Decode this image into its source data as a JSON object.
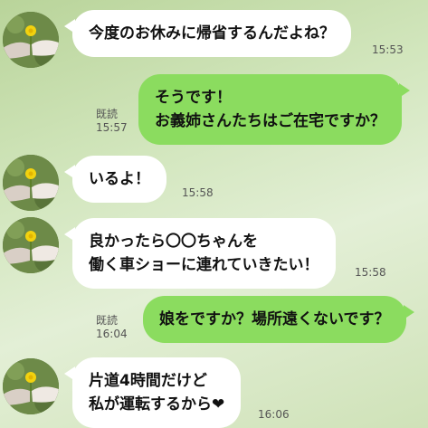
{
  "messages": [
    {
      "side": "in",
      "lines": [
        "今度のお休みに帰省するんだよね？"
      ],
      "time": "15:53"
    },
    {
      "side": "out",
      "lines": [
        "そうです！",
        "お義姉さんたちはご在宅ですか？"
      ],
      "read": "既読",
      "time": "15:57"
    },
    {
      "side": "in",
      "lines": [
        "いるよ！"
      ],
      "time": "15:58"
    },
    {
      "side": "in",
      "lines": [
        "良かったら〇〇ちゃんを",
        "働く車ショーに連れていきたい！"
      ],
      "time": "15:58"
    },
    {
      "side": "out",
      "lines": [
        "娘をですか？場所遠くないです？"
      ],
      "read": "既読",
      "time": "16:04"
    },
    {
      "side": "in",
      "lines": [
        "片道4時間だけど",
        "私が運転するから❤"
      ],
      "time": "16:06"
    }
  ]
}
